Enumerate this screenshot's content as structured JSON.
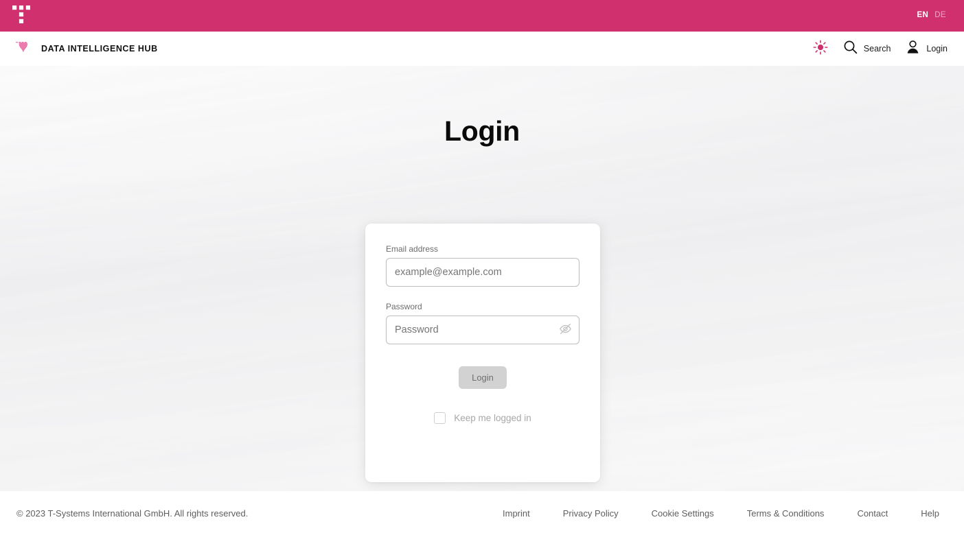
{
  "topbar": {
    "logo_icon": "telekom-t-logo",
    "background_color": "#d1306f",
    "languages": [
      {
        "code": "EN",
        "active": true
      },
      {
        "code": "DE",
        "active": false
      }
    ]
  },
  "header": {
    "brand_icon": "telekom-crown-icon",
    "brand_title": "DATA INTELLIGENCE HUB",
    "actions": [
      {
        "icon": "sun-brightness-icon",
        "label": "",
        "color": "#d1306f"
      },
      {
        "icon": "search-icon",
        "label": "Search"
      },
      {
        "icon": "user-account-icon",
        "label": "Login"
      }
    ]
  },
  "main": {
    "page_title": "Login",
    "card": {
      "email": {
        "label": "Email address",
        "placeholder": "example@example.com",
        "value": ""
      },
      "password": {
        "label": "Password",
        "placeholder": "Password",
        "value": "",
        "toggle_icon": "eye-slash-icon"
      },
      "submit": {
        "label": "Login",
        "disabled": true,
        "background_color": "#d2d2d2",
        "text_color": "#6f6f6f"
      },
      "keep_logged_in": {
        "label": "Keep me logged in",
        "checked": false
      }
    }
  },
  "footer": {
    "copyright": "© 2023 T-Systems International GmbH. All rights reserved.",
    "links": [
      {
        "label": "Imprint"
      },
      {
        "label": "Privacy Policy"
      },
      {
        "label": "Cookie Settings"
      },
      {
        "label": "Terms & Conditions"
      },
      {
        "label": "Contact"
      },
      {
        "label": "Help"
      }
    ]
  },
  "theme": {
    "magenta": "#d1306f",
    "hero_background": "#f2f2f3",
    "text_dark": "#0a0a0a",
    "text_muted": "#5e5e5e"
  }
}
